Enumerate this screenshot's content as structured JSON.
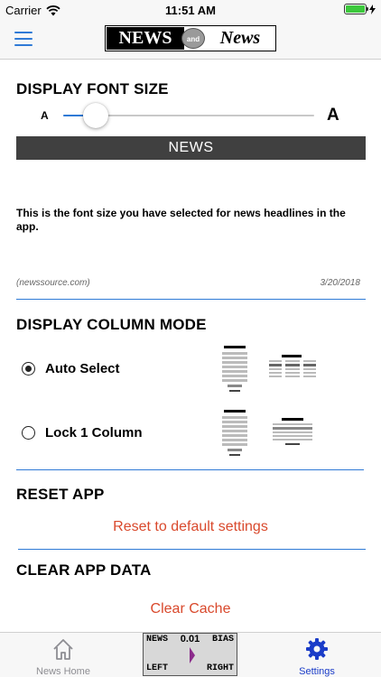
{
  "status_bar": {
    "carrier": "Carrier",
    "time": "11:51 AM",
    "battery_level": 1.0
  },
  "nav_bar": {
    "menu_icon": "hamburger-menu-icon",
    "logo": {
      "left_text": "NEWS",
      "middle_text": "and",
      "right_text": "News"
    }
  },
  "font_size": {
    "title": "DISPLAY FONT SIZE",
    "small_label": "A",
    "large_label": "A",
    "slider_value": 0.13,
    "preview": {
      "headline": "NEWS",
      "text": "This is the font size you have selected for news headlines in the app.",
      "source": "(newssource.com)",
      "date": "3/20/2018"
    }
  },
  "column_mode": {
    "title": "DISPLAY COLUMN MODE",
    "options": [
      {
        "label": "Auto Select",
        "selected": true
      },
      {
        "label": "Lock 1 Column",
        "selected": false
      }
    ]
  },
  "reset": {
    "title": "RESET APP",
    "action": "Reset to default settings"
  },
  "clear": {
    "title": "CLEAR APP DATA",
    "action": "Clear Cache"
  },
  "tab_bar": {
    "home_label": "News Home",
    "settings_label": "Settings",
    "bias": {
      "news": "NEWS",
      "value": "0.01",
      "bias": "BIAS",
      "left": "LEFT",
      "right": "RIGHT"
    }
  },
  "colors": {
    "accent": "#2f7ad6",
    "action": "#d9492c",
    "preview_bar": "#404040",
    "bias_pointer": "#8b2b8b"
  }
}
